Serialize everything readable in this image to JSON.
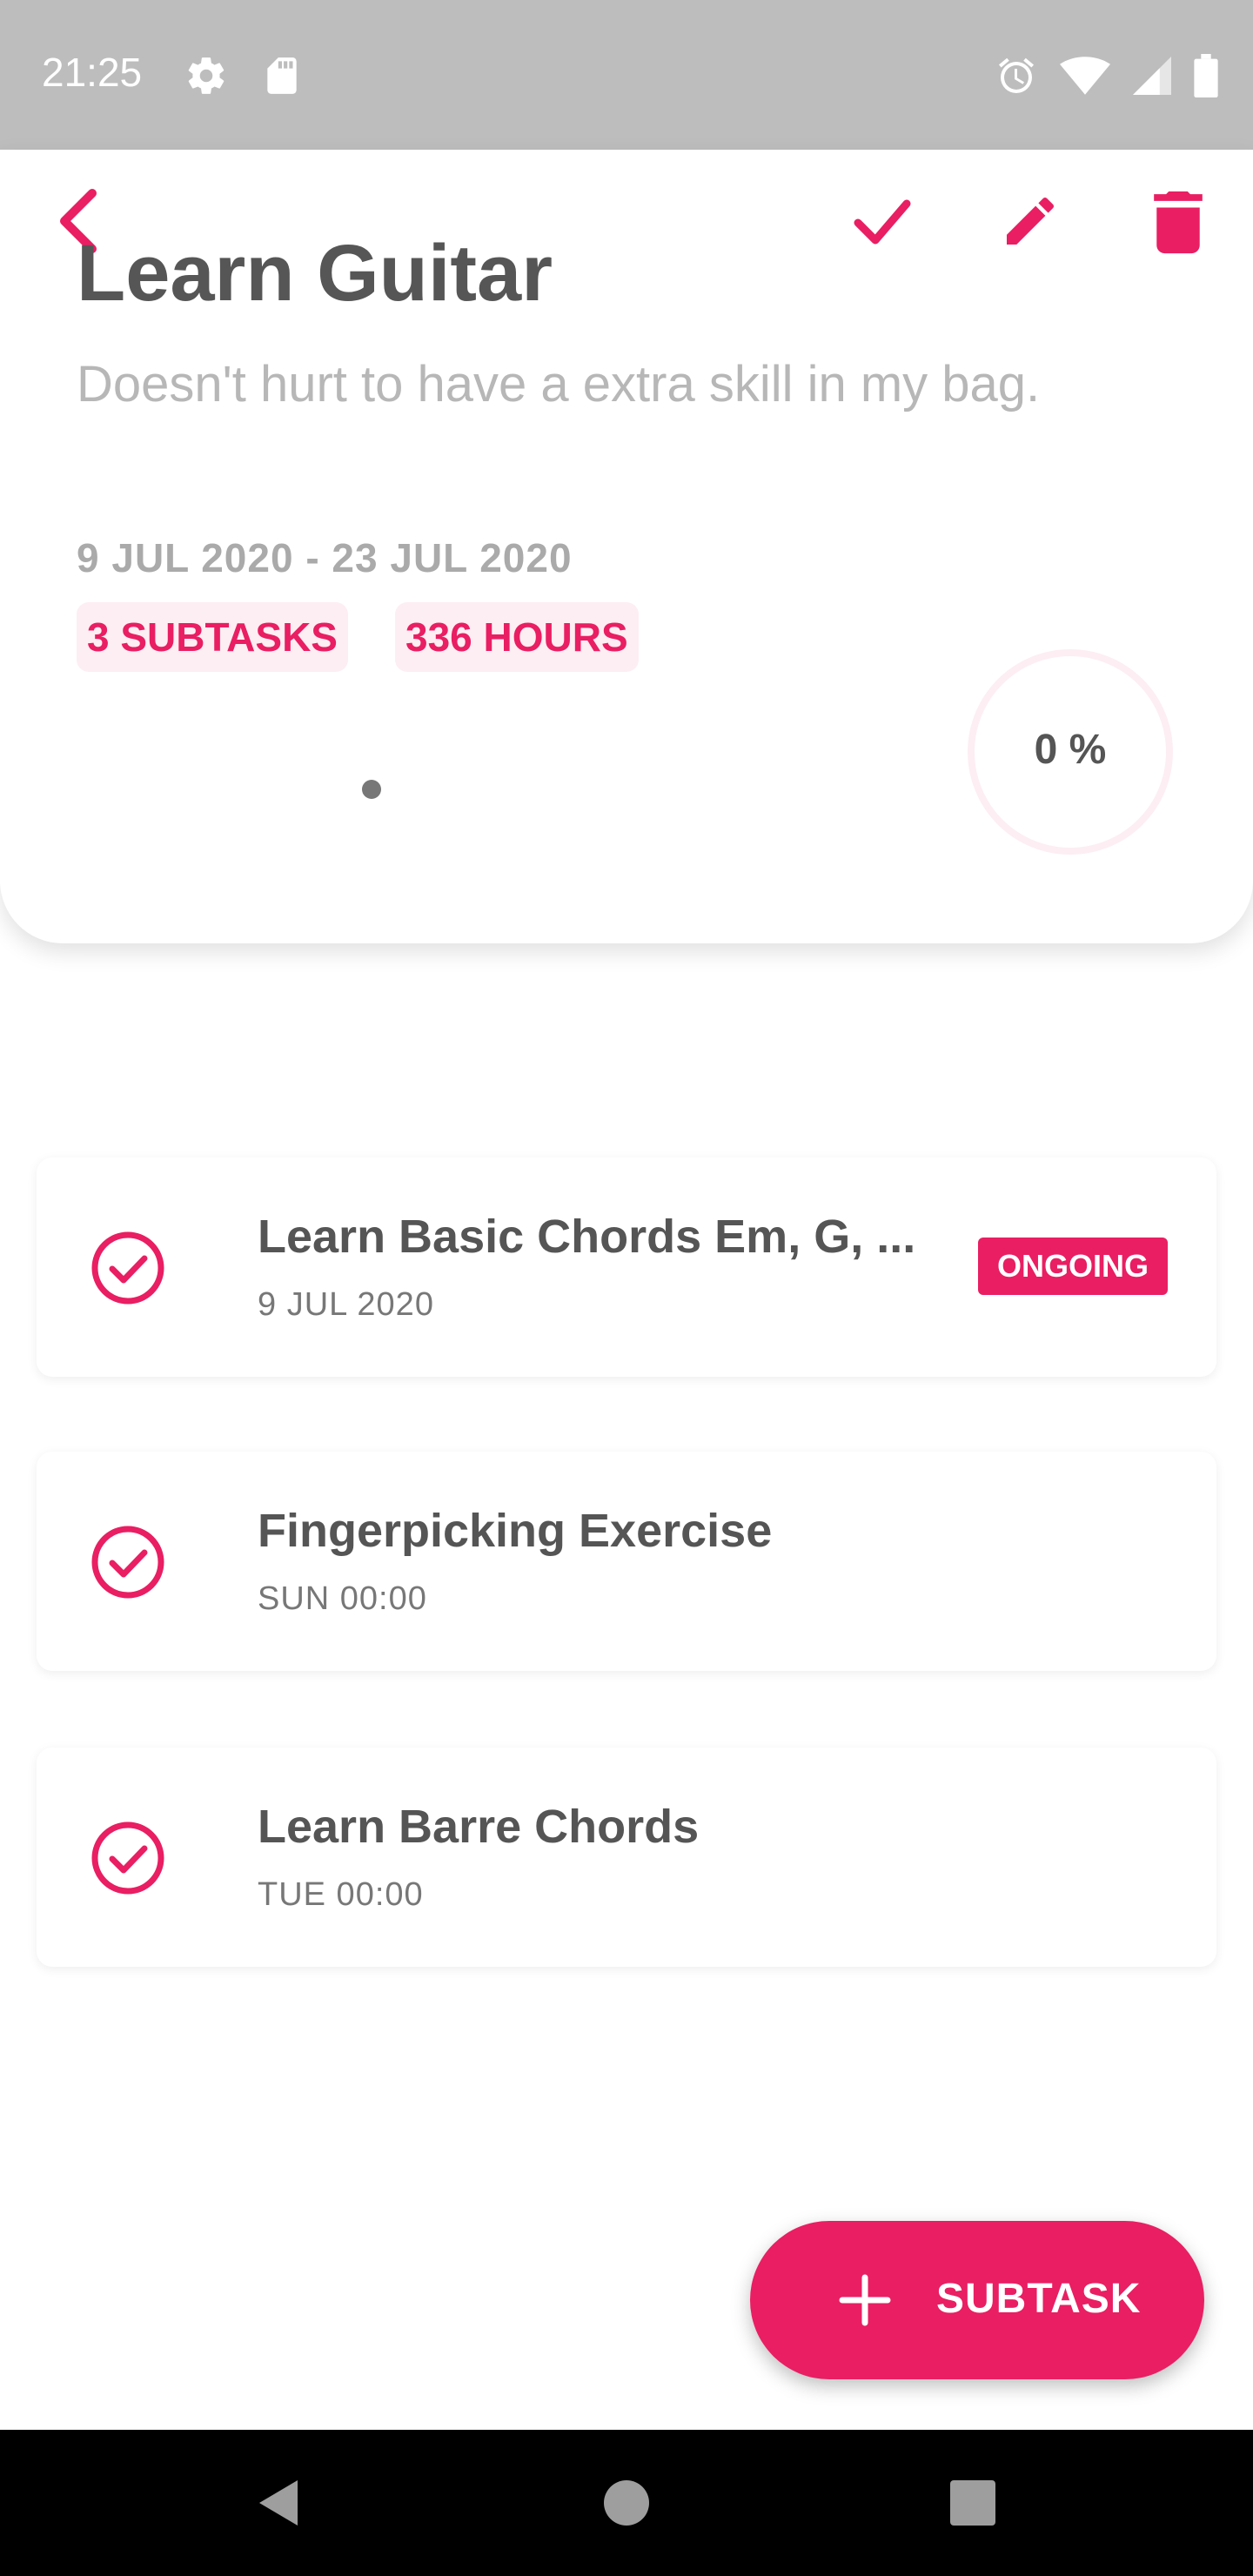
{
  "status_bar": {
    "time": "21:25",
    "left_icons": [
      "gear-icon",
      "sd-card-icon"
    ],
    "right_icons": [
      "alarm-icon",
      "wifi-icon",
      "signal-icon",
      "battery-icon"
    ]
  },
  "toolbar": {
    "back_icon": "chevron-left-icon",
    "actions": [
      "check-icon",
      "edit-icon",
      "trash-icon"
    ]
  },
  "goal": {
    "title": "Learn Guitar",
    "description": "Doesn't hurt to have a extra skill in my bag.",
    "date_range": "9 JUL 2020 - 23 JUL 2020",
    "subtasks_chip": "3 SUBTASKS",
    "hours_chip": "336 HOURS",
    "progress_label": "0 %",
    "progress_value": 0
  },
  "subtasks": [
    {
      "title": "Learn Basic Chords Em, G, ...",
      "subtitle": "9 JUL 2020",
      "badge": "ONGOING"
    },
    {
      "title": "Fingerpicking Exercise",
      "subtitle": "SUN 00:00"
    },
    {
      "title": "Learn Barre Chords",
      "subtitle": "TUE 00:00"
    }
  ],
  "fab": {
    "label": "SUBTASK",
    "icon": "plus-icon"
  },
  "nav_bar": {
    "buttons": [
      "back-triangle-icon",
      "home-circle-icon",
      "recents-square-icon"
    ]
  },
  "colors": {
    "accent": "#e91e63",
    "chip_background": "#fdeef3",
    "status_bar": "#bdbdbd",
    "title_text": "#565656",
    "muted_text": "#b7b7b7"
  }
}
